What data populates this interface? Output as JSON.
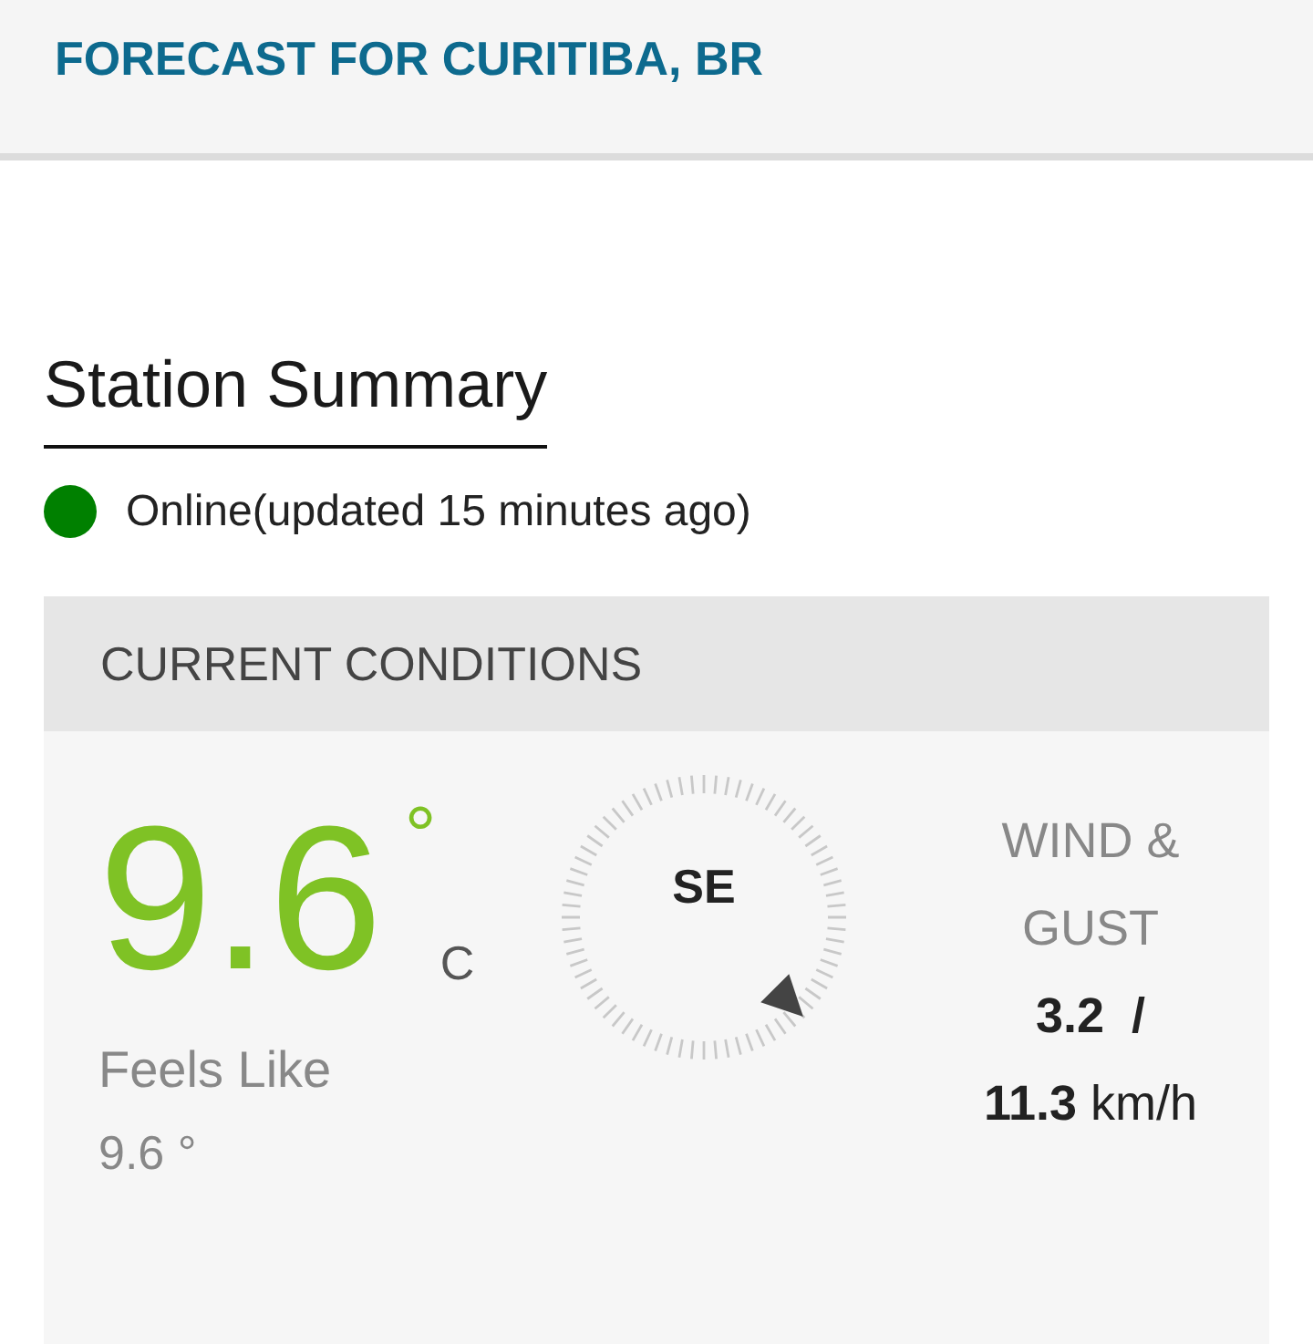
{
  "header": {
    "title": "FORECAST FOR CURITIBA, BR"
  },
  "station_summary": {
    "title": "Station Summary"
  },
  "status": {
    "text": "Online(updated 15 minutes ago)",
    "color": "#008000"
  },
  "current_conditions": {
    "title": "CURRENT CONDITIONS",
    "temperature": {
      "value": "9.6",
      "degree": "°",
      "unit": "C"
    },
    "feels_like": {
      "label": "Feels Like",
      "value": "9.6 °"
    },
    "compass": {
      "direction": "SE"
    },
    "wind": {
      "label": "WIND & GUST",
      "speed": "3.2  /",
      "gust": "**11.3** km/h"
    }
  }
}
